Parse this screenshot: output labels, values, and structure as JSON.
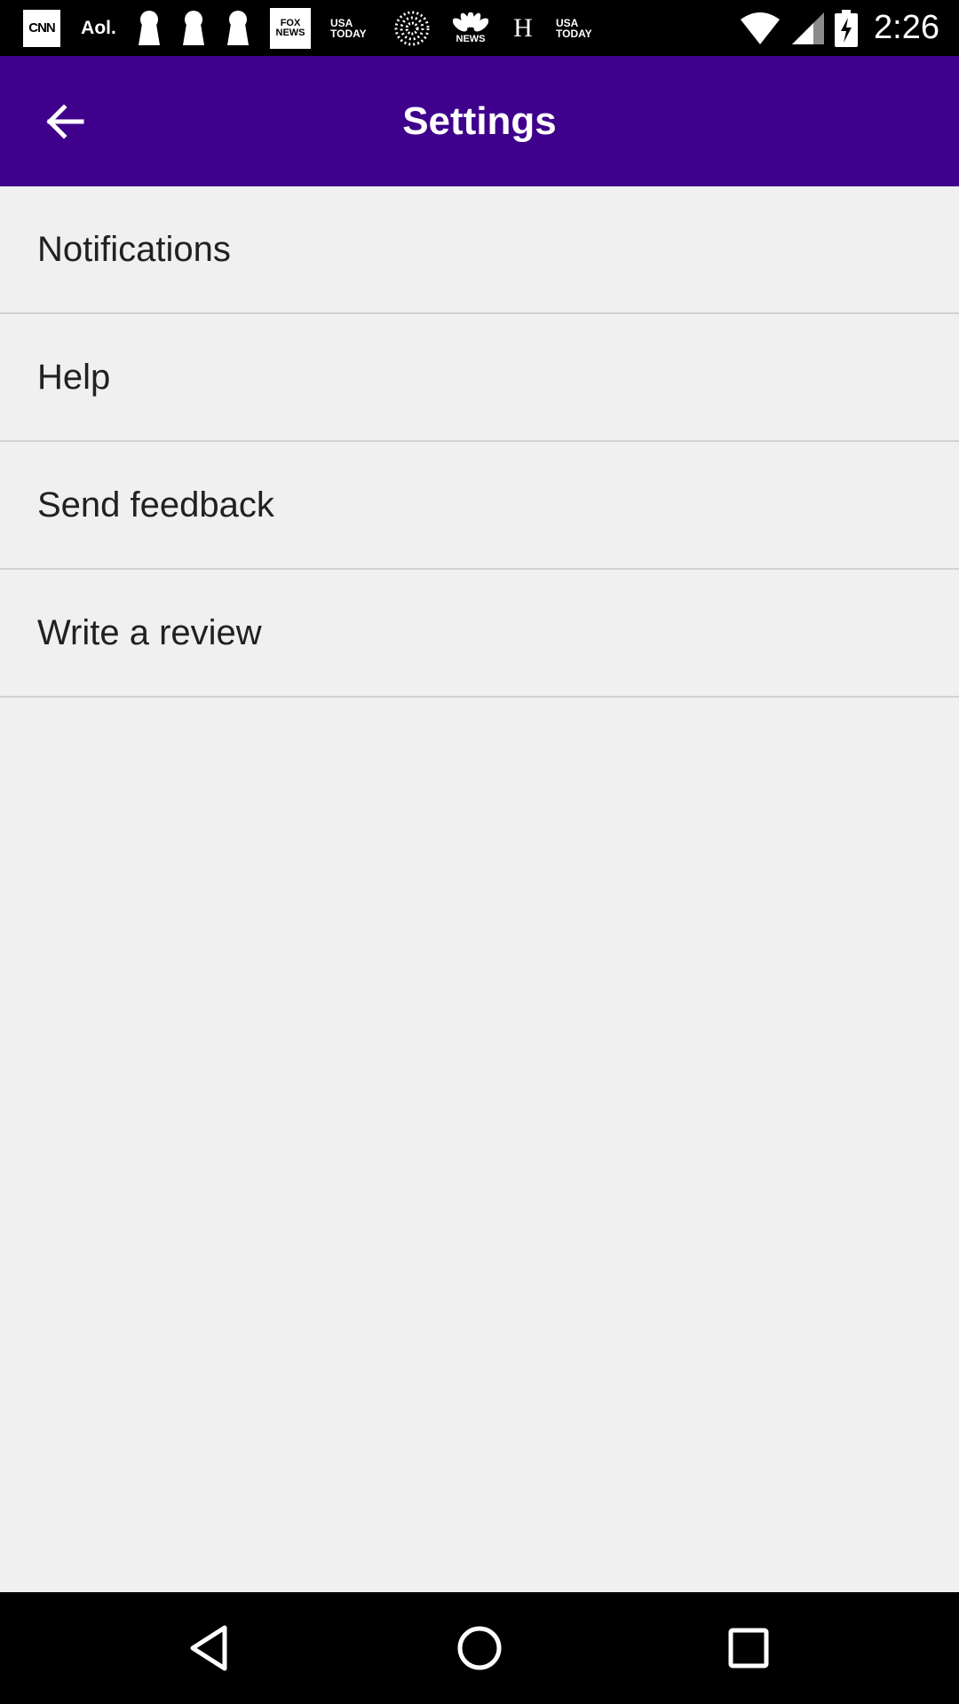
{
  "status_bar": {
    "time": "2:26",
    "notification_icons": [
      {
        "name": "cnn-icon",
        "text": "CNN"
      },
      {
        "name": "aol-icon",
        "text": "Aol."
      },
      {
        "name": "keyhole-icon"
      },
      {
        "name": "keyhole-icon"
      },
      {
        "name": "keyhole-icon"
      },
      {
        "name": "fox-news-icon",
        "text": "FOX NEWS"
      },
      {
        "name": "usa-today-icon",
        "text": "USA TODAY"
      },
      {
        "name": "dotted-circle-icon"
      },
      {
        "name": "nbc-news-icon",
        "text": "NEWS"
      },
      {
        "name": "h-icon",
        "text": "H"
      },
      {
        "name": "usa-today-icon",
        "text": "USA TODAY"
      }
    ],
    "system_icons": [
      "wifi-icon",
      "signal-icon",
      "battery-charging-icon"
    ]
  },
  "app_bar": {
    "title": "Settings",
    "back_icon": "arrow-back-icon",
    "color": "#3f008c"
  },
  "settings": {
    "items": [
      {
        "label": "Notifications"
      },
      {
        "label": "Help"
      },
      {
        "label": "Send feedback"
      },
      {
        "label": "Write a review"
      }
    ]
  },
  "nav_bar": {
    "buttons": [
      "back-triangle-icon",
      "home-circle-icon",
      "recents-square-icon"
    ]
  }
}
